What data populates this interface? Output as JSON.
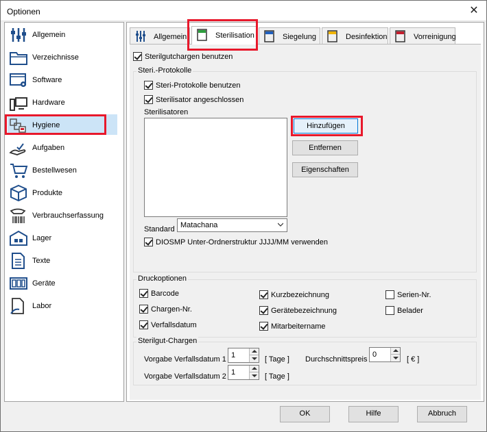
{
  "window": {
    "title": "Optionen",
    "close": "✕"
  },
  "nav": {
    "items": [
      {
        "label": "Allgemein",
        "icon": "sliders-icon"
      },
      {
        "label": "Verzeichnisse",
        "icon": "folder-icon"
      },
      {
        "label": "Software",
        "icon": "software-gear-icon"
      },
      {
        "label": "Hardware",
        "icon": "computer-icon"
      },
      {
        "label": "Hygiene",
        "icon": "hygiene-icon",
        "selected": true
      },
      {
        "label": "Aufgaben",
        "icon": "task-hand-icon"
      },
      {
        "label": "Bestellwesen",
        "icon": "cart-icon"
      },
      {
        "label": "Produkte",
        "icon": "box-icon"
      },
      {
        "label": "Verbrauchserfassung",
        "icon": "scanner-icon"
      },
      {
        "label": "Lager",
        "icon": "warehouse-icon"
      },
      {
        "label": "Texte",
        "icon": "document-icon"
      },
      {
        "label": "Geräte",
        "icon": "device-icon"
      },
      {
        "label": "Labor",
        "icon": "lab-icon"
      }
    ]
  },
  "tabs": [
    {
      "label": "Allgemein"
    },
    {
      "label": "Sterilisation",
      "active": true
    },
    {
      "label": "Siegelung"
    },
    {
      "label": "Desinfektion"
    },
    {
      "label": "Vorreinigung"
    }
  ],
  "sterilisation": {
    "use_sterilgut": "Sterilgutchargen benutzen",
    "protokolle": {
      "title": "Steri.-Protokolle",
      "use_protokolle": "Steri-Protokolle benutzen",
      "angeschlossen": "Sterilisator angeschlossen",
      "sterilisatoren": "Sterilisatoren",
      "btn_add": "Hinzufügen",
      "btn_remove": "Entfernen",
      "btn_props": "Eigenschaften",
      "standard_label": "Standard",
      "standard_value": "Matachana",
      "diosmp": "DIOSMP Unter-Ordnerstruktur JJJJ/MM verwenden"
    },
    "druck": {
      "title": "Druckoptionen",
      "barcode": "Barcode",
      "chargen": "Chargen-Nr.",
      "verfall": "Verfallsdatum",
      "kurz": "Kurzbezeichnung",
      "geraete": "Gerätebezeichnung",
      "mitarbeiter": "Mitarbeitername",
      "serien": "Serien-Nr.",
      "belader": "Belader"
    },
    "chargen": {
      "title": "Sterilgut-Chargen",
      "vorgabe1": "Vorgabe Verfallsdatum 1",
      "vorgabe1_value": "1",
      "vorgabe2": "Vorgabe Verfallsdatum 2",
      "vorgabe2_value": "1",
      "unit_tage": "[ Tage ]",
      "durchschnitt": "Durchschnittspreis",
      "durchschnitt_value": "0",
      "unit_euro": "[ € ]"
    }
  },
  "buttons": {
    "ok": "OK",
    "hilfe": "Hilfe",
    "abbruch": "Abbruch"
  },
  "colors": {
    "highlight": "#e8182b",
    "selection": "#cce4f7",
    "focus": "#0078d7"
  }
}
